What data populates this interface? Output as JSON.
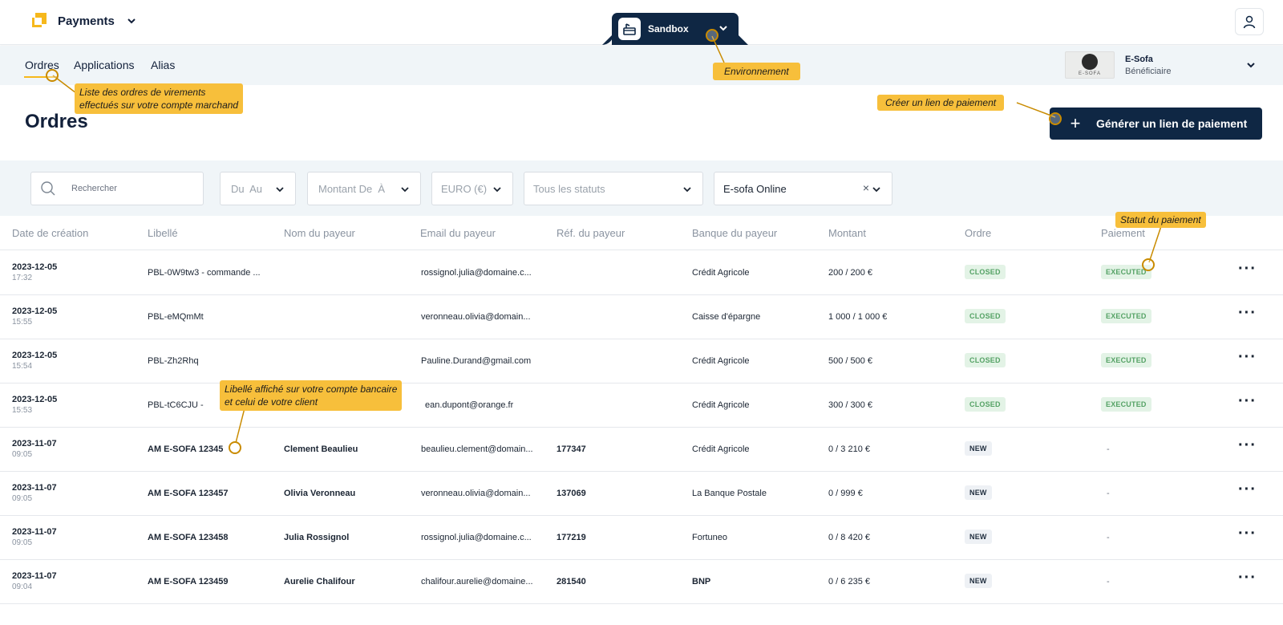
{
  "app": {
    "name": "Payments"
  },
  "environment": {
    "label": "Sandbox"
  },
  "nav": {
    "items": [
      "Ordres",
      "Applications",
      "Alias"
    ]
  },
  "merchant": {
    "logo_text": "E-SOFA",
    "name": "E-Sofa",
    "role": "Bénéficiaire"
  },
  "page": {
    "title": "Ordres",
    "generate_button": "Générer un lien de paiement"
  },
  "filters": {
    "search_placeholder": "Rechercher",
    "date": "Du  Au",
    "amount": "Montant De  À",
    "currency": "EURO (€)",
    "status": "Tous les statuts",
    "application": "E-sofa Online"
  },
  "table": {
    "headers": [
      "Date de création",
      "Libellé",
      "Nom du payeur",
      "Email du payeur",
      "Réf. du payeur",
      "Banque du payeur",
      "Montant",
      "Ordre",
      "Paiement"
    ],
    "rows": [
      {
        "date": "2023-12-05",
        "time": "17:32",
        "label": "PBL-0W9tw3 - commande ...",
        "payer": "",
        "email": "rossignol.julia@domaine.c...",
        "ref": "",
        "bank": "Crédit Agricole",
        "amount": "200 / 200 €",
        "order": "CLOSED",
        "payment": "EXECUTED"
      },
      {
        "date": "2023-12-05",
        "time": "15:55",
        "label": "PBL-eMQmMt",
        "payer": "",
        "email": "veronneau.olivia@domain...",
        "ref": "",
        "bank": "Caisse d'épargne",
        "amount": "1 000 / 1 000 €",
        "order": "CLOSED",
        "payment": "EXECUTED"
      },
      {
        "date": "2023-12-05",
        "time": "15:54",
        "label": "PBL-Zh2Rhq",
        "payer": "",
        "email": "Pauline.Durand@gmail.com",
        "ref": "",
        "bank": "Crédit Agricole",
        "amount": "500 / 500 €",
        "order": "CLOSED",
        "payment": "EXECUTED"
      },
      {
        "date": "2023-12-05",
        "time": "15:53",
        "label": "PBL-tC6CJU -",
        "payer": "",
        "email": "ean.dupont@orange.fr",
        "ref": "",
        "bank": "Crédit Agricole",
        "amount": "300 / 300 €",
        "order": "CLOSED",
        "payment": "EXECUTED"
      },
      {
        "date": "2023-11-07",
        "time": "09:05",
        "label": "AM E-SOFA 12345",
        "payer": "Clement Beaulieu",
        "email": "beaulieu.clement@domain...",
        "ref": "177347",
        "bank": "Crédit Agricole",
        "amount": "0 / 3 210 €",
        "order": "NEW",
        "payment": "-"
      },
      {
        "date": "2023-11-07",
        "time": "09:05",
        "label": "AM E-SOFA 123457",
        "payer": "Olivia Veronneau",
        "email": "veronneau.olivia@domain...",
        "ref": "137069",
        "bank": "La Banque Postale",
        "amount": "0 / 999 €",
        "order": "NEW",
        "payment": "-"
      },
      {
        "date": "2023-11-07",
        "time": "09:05",
        "label": "AM E-SOFA 123458",
        "payer": "Julia Rossignol",
        "email": "rossignol.julia@domaine.c...",
        "ref": "177219",
        "bank": "Fortuneo",
        "amount": "0 / 8 420 €",
        "order": "NEW",
        "payment": "-"
      },
      {
        "date": "2023-11-07",
        "time": "09:04",
        "label": "AM E-SOFA 123459",
        "payer": "Aurelie Chalifour",
        "email": "chalifour.aurelie@domaine...",
        "ref": "281540",
        "bank": "BNP",
        "amount": "0 / 6 235 €",
        "order": "NEW",
        "payment": "-"
      }
    ]
  },
  "callouts": {
    "environment": "Environnement",
    "orders": [
      "Liste des ordres de virements",
      "effectués sur votre compte marchand"
    ],
    "create_link": "Créer un lien de paiement",
    "payment_status": "Statut du paiement",
    "label": [
      "Libellé affiché sur votre compte bancaire",
      "et celui de votre client"
    ]
  },
  "colors": {
    "navy": "#0f2744",
    "accent": "#f6b81c",
    "callout": "#f7bf3b",
    "success_bg": "#e3f3e6",
    "success_text": "#55a265"
  }
}
